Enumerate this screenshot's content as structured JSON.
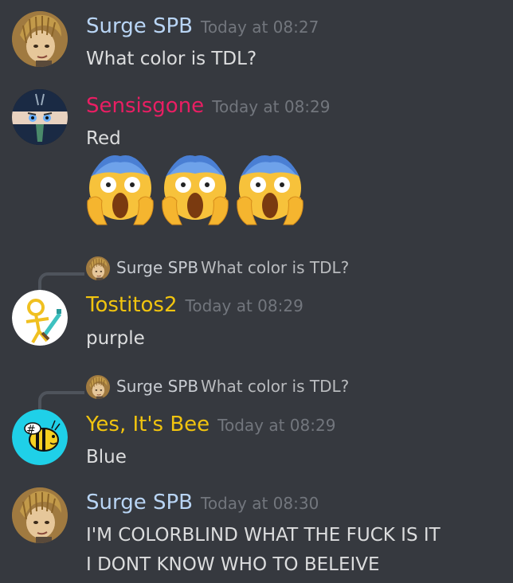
{
  "messages": [
    {
      "author": "Surge SPB",
      "author_color": "#b9d5f5",
      "time": "Today at 08:27",
      "lines": [
        "What color is TDL?"
      ]
    },
    {
      "author": "Sensisgone",
      "author_color": "#e91e63",
      "time": "Today at 08:29",
      "lines": [
        "Red"
      ],
      "reactions": [
        "face-screaming-in-fear",
        "face-screaming-in-fear",
        "face-screaming-in-fear"
      ]
    },
    {
      "reply": {
        "author": "Surge SPB",
        "text": "What color is TDL?"
      },
      "author": "Tostitos2",
      "author_color": "#f1c40f",
      "time": "Today at 08:29",
      "lines": [
        "purple"
      ]
    },
    {
      "reply": {
        "author": "Surge SPB",
        "text": "What color is TDL?"
      },
      "author": "Yes, It's Bee",
      "author_color": "#f1c40f",
      "time": "Today at 08:29",
      "lines": [
        "Blue"
      ]
    },
    {
      "author": "Surge SPB",
      "author_color": "#b9d5f5",
      "time": "Today at 08:30",
      "lines": [
        "I'M COLORBLIND WHAT THE FUCK IS IT",
        "I DONT KNOW WHO TO BELEIVE"
      ]
    }
  ]
}
